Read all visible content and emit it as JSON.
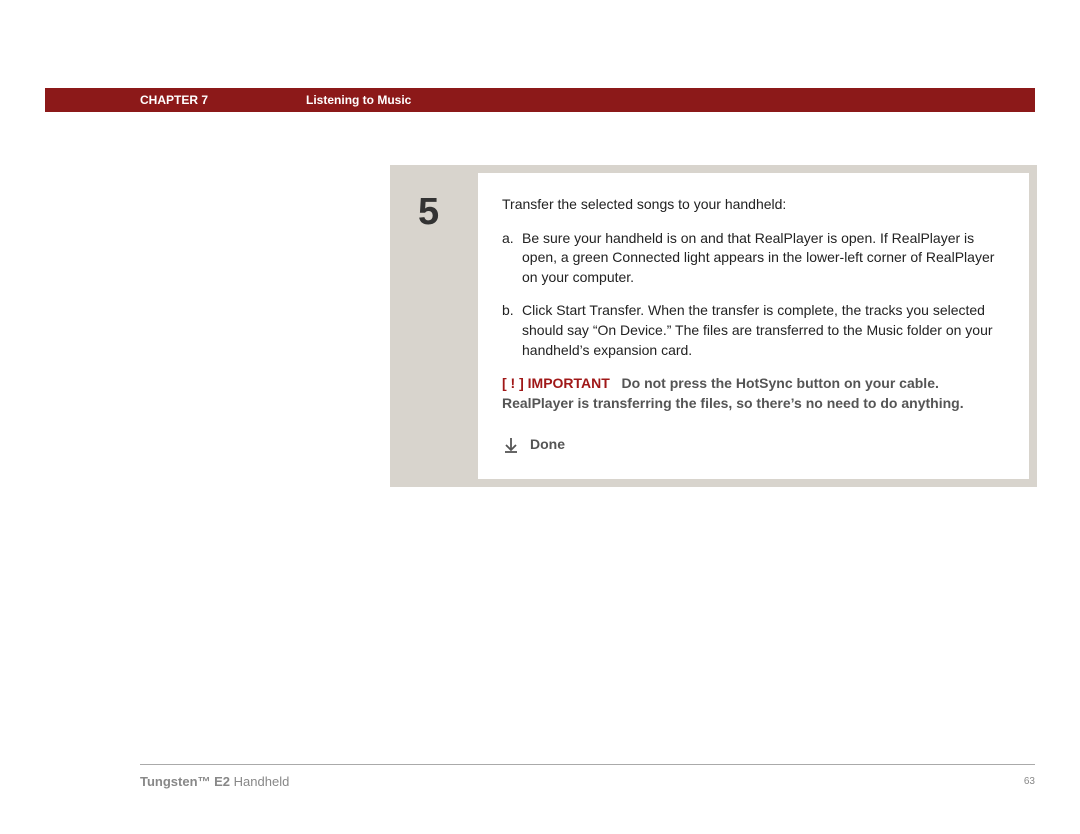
{
  "header": {
    "chapter_label": "CHAPTER 7",
    "chapter_title": "Listening to Music"
  },
  "step": {
    "number": "5",
    "intro": "Transfer the selected songs to your handheld:",
    "items": [
      {
        "letter": "a.",
        "text": "Be sure your handheld is on and that RealPlayer is open. If RealPlayer is open, a green Connected light appears in the lower-left corner of RealPlayer on your computer."
      },
      {
        "letter": "b.",
        "text": "Click Start Transfer. When the transfer is complete, the tracks you selected should say “On Device.” The files are transferred to the Music folder on your handheld’s expansion card."
      }
    ],
    "important_tag": "[ ! ] IMPORTANT",
    "important_text": "Do not press the HotSync button on your cable. RealPlayer is transferring the files, so there’s no need to do anything.",
    "done_label": "Done"
  },
  "footer": {
    "product_bold": "Tungsten™ E2",
    "product_rest": " Handheld",
    "page_number": "63"
  }
}
